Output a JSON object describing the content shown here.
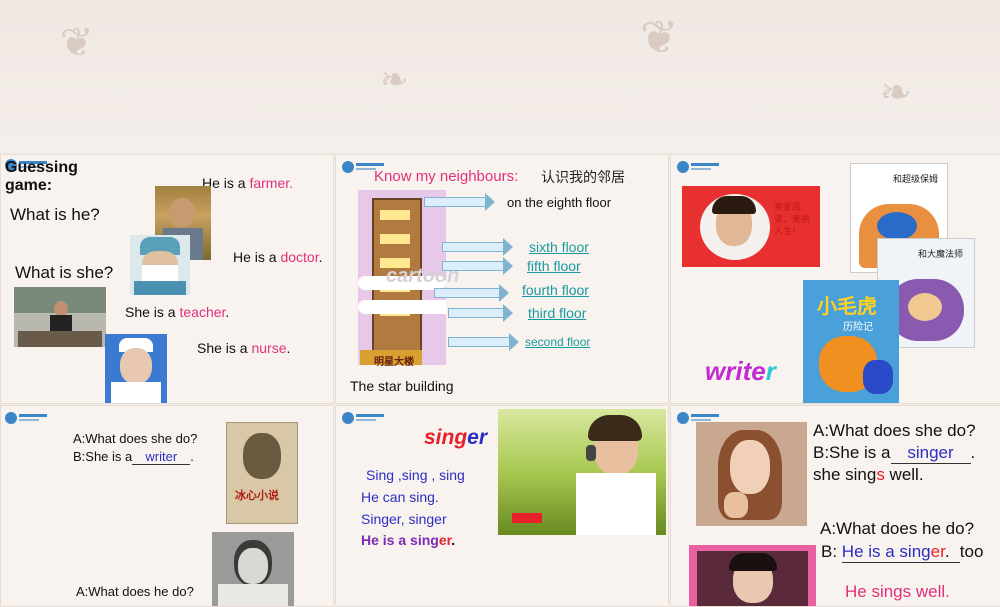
{
  "slide1": {
    "title": "Guessing game:",
    "q_he": "What is he?",
    "q_she": "What is she?",
    "s1_prefix": "He is a ",
    "s1_job": "farmer.",
    "s2_prefix": "He is a ",
    "s2_job": "doctor",
    "s2_end": ".",
    "s3_prefix": "She is a ",
    "s3_job": "teacher",
    "s3_end": ".",
    "s4_prefix": "She is a ",
    "s4_job": "nurse",
    "s4_end": "."
  },
  "slide2": {
    "title": "Know my neighbours:",
    "title_cn": "认识我的邻居",
    "floor8": "on the eighth floor",
    "floors": [
      "sixth floor",
      "fifth floor",
      "fourth floor",
      "third floor",
      "second floor"
    ],
    "building_sign": "明星大楼",
    "caption": "The  star building",
    "watermark": "cartoon"
  },
  "slide3": {
    "book1_title": "和超级保姆",
    "book2_title": "和大魔法师",
    "book3_title": "小毛虎",
    "book3_sub": "历险记",
    "portrait_text": "喜爱阅读，美丽人生！",
    "word_main": "write",
    "word_suffix": "r"
  },
  "slide4": {
    "q1": "A:What does she do?",
    "a1_prefix": "B:She is a",
    "a1_answer": "writer",
    "a1_end": ".",
    "book_title": "冰心小说",
    "q2": "A:What does he do?"
  },
  "slide5": {
    "word_main": "sing",
    "word_suffix": "er",
    "line1": "Sing ,sing , sing",
    "line2": "He can sing.",
    "line3": "Singer, singer",
    "line4_prefix": "He is a sing",
    "line4_suffix": "er",
    "line4_end": "."
  },
  "slide6": {
    "q1": "A:What does she do?",
    "a1_prefix": "B:She is  a",
    "a1_answer": "singer",
    "a1_end": ".",
    "line_sings_prefix": "she sing",
    "line_sings_s": "s",
    "line_sings_end": " well.",
    "q2": "A:What  does he do?",
    "a2_prefix": "B: ",
    "a2_answer_pre": "He is a sing",
    "a2_answer_er": "er",
    "a2_answer_end": ".",
    "a2_too": "too",
    "line_he": "He sings well."
  },
  "colors": {
    "pink": "#e0317a",
    "teal": "#1a9aa0",
    "navy": "#2b2ec4",
    "purple": "#7a2ab5",
    "red": "#e8202a"
  }
}
